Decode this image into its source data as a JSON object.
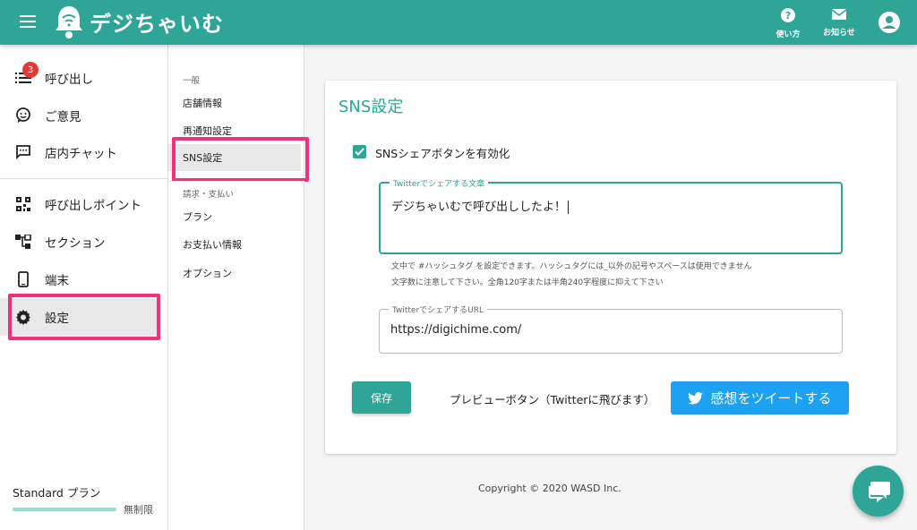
{
  "app": {
    "logo_text": "デジちゃいむ",
    "help_label": "使い方",
    "notice_label": "お知らせ"
  },
  "colors": {
    "primary": "#2ea597",
    "highlight": "#f0327a",
    "badge": "#e53935",
    "twitter": "#1da1f2"
  },
  "sidebar": {
    "items": [
      {
        "label": "呼び出し",
        "icon": "list-icon",
        "badge": "3"
      },
      {
        "label": "ご意見",
        "icon": "feedback-icon"
      },
      {
        "label": "店内チャット",
        "icon": "chat-icon"
      },
      {
        "label": "呼び出しポイント",
        "icon": "qr-icon"
      },
      {
        "label": "セクション",
        "icon": "section-icon"
      },
      {
        "label": "端末",
        "icon": "phone-icon"
      },
      {
        "label": "設定",
        "icon": "gear-icon"
      }
    ],
    "plan": {
      "name": "Standard プラン",
      "limit": "無制限"
    }
  },
  "subnav": {
    "general_heading": "一般",
    "general_items": [
      "店舗情報",
      "再通知設定",
      "SNS設定"
    ],
    "billing_heading": "請求・支払い",
    "billing_items": [
      "プラン",
      "お支払い情報",
      "オプション"
    ]
  },
  "main": {
    "title": "SNS設定",
    "enable_checkbox_label": "SNSシェアボタンを有効化",
    "enable_checked": true,
    "tweet_text_label": "Twitterでシェアする文章",
    "tweet_text_value": "デジちゃいむで呼び出ししたよ！",
    "hint_line_1": "文中で #ハッシュタグ を設定できます。ハッシュタグには_以外の記号やスペースは使用できません",
    "hint_line_2": "文字数に注意して下さい。全角120字または半角240字程度に抑えて下さい",
    "share_url_label": "TwitterでシェアするURL",
    "share_url_value": "https://digichime.com/",
    "save_label": "保存",
    "preview_label": "プレビューボタン（Twitterに飛びます）",
    "tweet_button_label": "感想をツイートする"
  },
  "footer": {
    "copyright": "Copyright © 2020 WASD Inc."
  }
}
